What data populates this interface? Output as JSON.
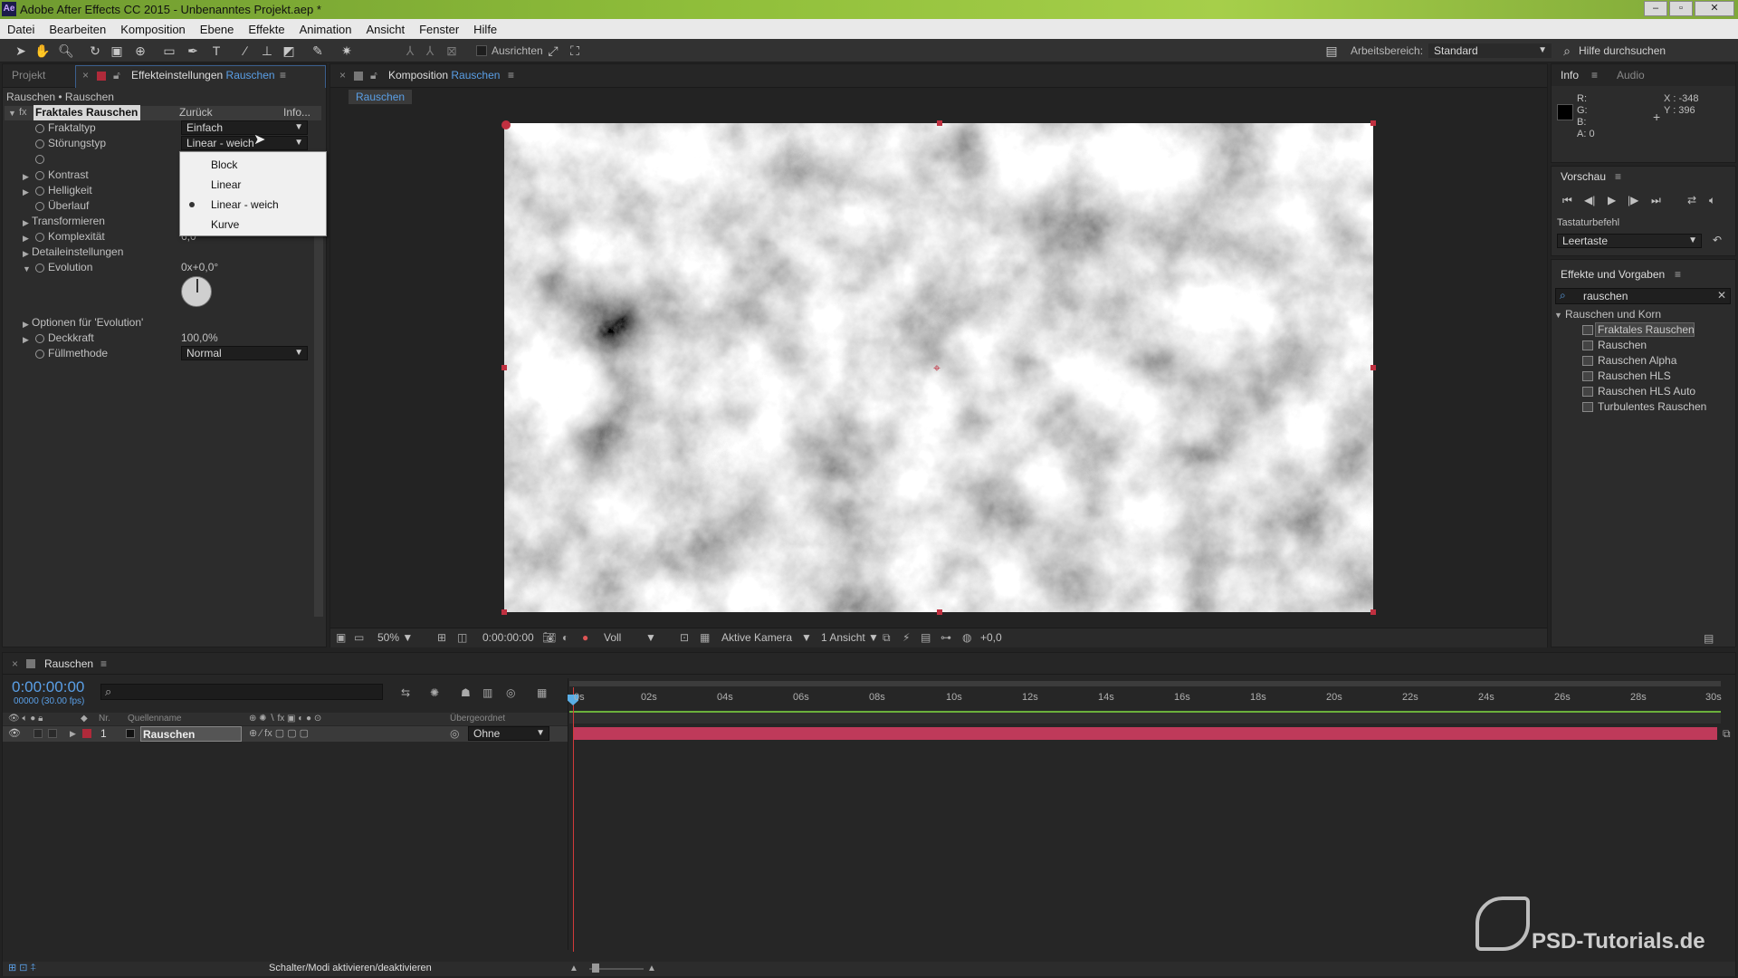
{
  "window": {
    "title": "Adobe After Effects CC 2015 - Unbenanntes Projekt.aep *",
    "app_badge": "Ae"
  },
  "menu": [
    "Datei",
    "Bearbeiten",
    "Komposition",
    "Ebene",
    "Effekte",
    "Animation",
    "Ansicht",
    "Fenster",
    "Hilfe"
  ],
  "toolbar": {
    "align_label": "Ausrichten",
    "workspace_label": "Arbeitsbereich:",
    "workspace_value": "Standard",
    "help_placeholder": "Hilfe durchsuchen"
  },
  "left_panel": {
    "tab_project": "Projekt",
    "tab_effects": "Effekteinstellungen",
    "tab_effects_layer": "Rauschen",
    "breadcrumb": "Rauschen • Rauschen",
    "effect_name": "Fraktales Rauschen",
    "reset": "Zurück",
    "info": "Info...",
    "props": {
      "fraktaltyp": "Fraktaltyp",
      "fraktaltyp_value": "Einfach",
      "stoerungstyp": "Störungstyp",
      "stoerungstyp_value": "Linear - weich",
      "kontrast": "Kontrast",
      "helligkeit": "Helligkeit",
      "ueberlauf": "Überlauf",
      "transformieren": "Transformieren",
      "komplexitaet": "Komplexität",
      "komplexitaet_value": "6,0",
      "details": "Detaileinstellungen",
      "evolution": "Evolution",
      "evolution_value": "0x+0,0°",
      "evo_options": "Optionen für 'Evolution'",
      "deckkraft": "Deckkraft",
      "deckkraft_value": "100,0%",
      "fuellmethode": "Füllmethode",
      "fuellmethode_value": "Normal"
    },
    "dropdown_options": [
      "Block",
      "Linear",
      "Linear - weich",
      "Kurve"
    ],
    "dropdown_selected": "Linear - weich"
  },
  "comp_panel": {
    "tab_label": "Komposition",
    "tab_comp": "Rauschen",
    "subtab": "Rauschen",
    "zoom": "50%",
    "timecode": "0:00:00:00",
    "resolution": "Voll",
    "camera": "Aktive Kamera",
    "views": "1 Ansicht",
    "exposure": "+0,0"
  },
  "info_panel": {
    "tab_info": "Info",
    "tab_audio": "Audio",
    "r": "R:",
    "g": "G:",
    "b": "B:",
    "a": "A:  0",
    "x": "X : -348",
    "y": "Y : 396"
  },
  "preview_panel": {
    "title": "Vorschau",
    "shortcut_label": "Tastaturbefehl",
    "shortcut_value": "Leertaste"
  },
  "effects_presets": {
    "title": "Effekte und Vorgaben",
    "search": "rauschen",
    "category": "Rauschen und Korn",
    "items": [
      "Fraktales Rauschen",
      "Rauschen",
      "Rauschen Alpha",
      "Rauschen HLS",
      "Rauschen HLS Auto",
      "Turbulentes Rauschen"
    ]
  },
  "timeline": {
    "tab": "Rauschen",
    "timecode": "0:00:00:00",
    "fps": "00000 (30.00 fps)",
    "col_nr": "Nr.",
    "col_source": "Quellenname",
    "col_parent": "Übergeordnet",
    "layer_nr": "1",
    "layer_name": "Rauschen",
    "parent_value": "Ohne",
    "ticks": [
      "0s",
      "02s",
      "04s",
      "06s",
      "08s",
      "10s",
      "12s",
      "14s",
      "16s",
      "18s",
      "20s",
      "22s",
      "24s",
      "26s",
      "28s",
      "30s"
    ],
    "footer": "Schalter/Modi aktivieren/deaktivieren"
  },
  "watermark": "PSD-Tutorials.de"
}
